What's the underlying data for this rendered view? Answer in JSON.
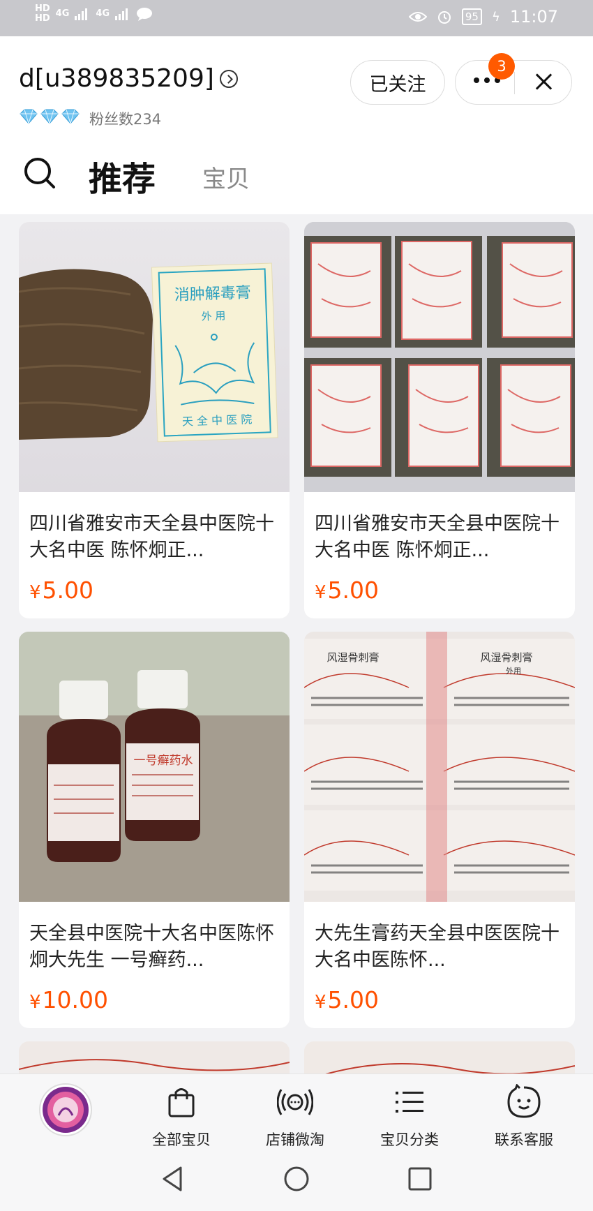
{
  "status_bar": {
    "network_left": [
      "HD",
      "HD"
    ],
    "signal_labels": [
      "4G",
      "4G"
    ],
    "battery": "95",
    "time": "11:07"
  },
  "header": {
    "shop_name": "d[u389835209]",
    "fans": "粉丝数234",
    "follow_label": "已关注",
    "notification_count": "3"
  },
  "tabs": {
    "recommend": "推荐",
    "items": "宝贝"
  },
  "products": [
    {
      "title": "四川省雅安市天全县中医院十大名中医 陈怀炯正...",
      "currency": "¥",
      "price": "5.00",
      "image": {
        "label_title": "消肿解毒膏",
        "label_sub": "外 用",
        "label_footer": "天 全 中 医 院"
      }
    },
    {
      "title": "四川省雅安市天全县中医院十大名中医 陈怀炯正...",
      "currency": "¥",
      "price": "5.00"
    },
    {
      "title": "天全县中医院十大名中医陈怀炯大先生 一号癣药...",
      "currency": "¥",
      "price": "10.00",
      "image": {
        "bottle_label": "一号癣药水"
      }
    },
    {
      "title": "大先生膏药天全县中医医院十大名中医陈怀...",
      "currency": "¥",
      "price": "5.00",
      "image": {
        "plaster_label": "风湿骨刺膏",
        "plaster_sub": "外用"
      }
    }
  ],
  "tab_bar": [
    {
      "label": "全部宝贝",
      "icon": "shopping-bag-icon"
    },
    {
      "label": "店铺微淘",
      "icon": "broadcast-icon"
    },
    {
      "label": "宝贝分类",
      "icon": "list-icon"
    },
    {
      "label": "联系客服",
      "icon": "chat-face-icon"
    }
  ],
  "colors": {
    "accent": "#ff5000",
    "badge": "#ff5a00",
    "diamond": "#6fc3f0"
  }
}
